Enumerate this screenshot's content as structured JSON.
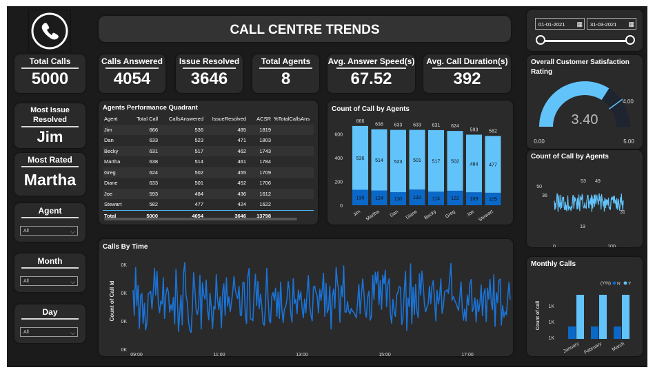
{
  "header": {
    "title": "CALL CENTRE TRENDS"
  },
  "date_range": {
    "start": "01-01-2021",
    "end": "31-03-2021",
    "selected_fraction": [
      0,
      1
    ]
  },
  "kpis": {
    "total_calls": {
      "label": "Total Calls",
      "value": "5000"
    },
    "calls_answered": {
      "label": "Calls Answered",
      "value": "4054"
    },
    "issue_resolved": {
      "label": "Issue Resolved",
      "value": "3646"
    },
    "total_agents": {
      "label": "Total Agents",
      "value": "8"
    },
    "avg_answer_speed": {
      "label": "Avg. Answer Speed(s)",
      "value": "67.52"
    },
    "avg_call_duration": {
      "label": "Avg. Call Duration(s)",
      "value": "392"
    }
  },
  "most_issue_resolved": {
    "label": "Most Issue Resolved",
    "value": "Jim"
  },
  "most_rated": {
    "label": "Most Rated",
    "value": "Martha"
  },
  "slicers": {
    "agent": {
      "label": "Agent",
      "value": "All"
    },
    "month": {
      "label": "Month",
      "value": "All"
    },
    "day": {
      "label": "Day",
      "value": "All"
    }
  },
  "table": {
    "title": "Agents Performance Quadrant",
    "columns": [
      "Agent",
      "Total Call",
      "CallsAnswered",
      "IssueResolved",
      "ACSR",
      "%TotalCallsAns"
    ],
    "rows": [
      [
        "Jim",
        "666",
        "536",
        "485",
        "1819"
      ],
      [
        "Dan",
        "633",
        "523",
        "471",
        "1803"
      ],
      [
        "Becky",
        "631",
        "517",
        "462",
        "1743"
      ],
      [
        "Martha",
        "638",
        "514",
        "461",
        "1784"
      ],
      [
        "Greg",
        "624",
        "502",
        "455",
        "1709"
      ],
      [
        "Diane",
        "633",
        "501",
        "452",
        "1706"
      ],
      [
        "Joe",
        "593",
        "484",
        "436",
        "1612"
      ],
      [
        "Stewart",
        "582",
        "477",
        "424",
        "1622"
      ]
    ],
    "total": [
      "Total",
      "5000",
      "4054",
      "3646",
      "13798"
    ]
  },
  "chart_data": [
    {
      "type": "bar",
      "title": "Count of Call by Agents",
      "stacked": true,
      "categories": [
        "Jim",
        "Martha",
        "Dan",
        "Diane",
        "Becky",
        "Greg",
        "Joe",
        "Stewart"
      ],
      "totals": [
        666,
        638,
        633,
        633,
        631,
        624,
        593,
        582
      ],
      "series": [
        {
          "values": [
            130,
            124,
            110,
            132,
            114,
            122,
            109,
            105
          ],
          "color": "#0a68c9"
        },
        {
          "values": [
            536,
            514,
            523,
            501,
            517,
            502,
            484,
            477
          ],
          "color": "#62c3fb"
        }
      ],
      "yticks": [
        0,
        200,
        400,
        600
      ],
      "ylim": [
        0,
        700
      ]
    },
    {
      "type": "line",
      "title": "Calls By Time",
      "ylabel": "Count of Call Id",
      "yticks": [
        "0K",
        "0K",
        "0K",
        "0K"
      ],
      "xticks": [
        "09:00",
        "11:00",
        "13:00",
        "15:00",
        "17:00"
      ],
      "color": "#1b73d6"
    },
    {
      "type": "line",
      "title": "Count of Call by Agents",
      "ytick": "50",
      "xticks": [
        "0",
        "100"
      ],
      "labels": [
        "36",
        "53",
        "49",
        "19",
        "31"
      ],
      "color": "#62c3fb"
    },
    {
      "type": "bar",
      "title": "Monthly Calls",
      "ylabel": "Count of call",
      "legend_title": "(Y/N)",
      "legend": [
        "N",
        "Y"
      ],
      "categories": [
        "January",
        "February",
        "March"
      ],
      "yticks": [
        "1K",
        "1K",
        "1K"
      ],
      "series": [
        {
          "name": "N",
          "values": [
            0.28,
            0.28,
            0.28
          ],
          "color": "#0a68c9"
        },
        {
          "name": "Y",
          "values": [
            1.0,
            1.0,
            1.0
          ],
          "color": "#62c3fb"
        }
      ]
    }
  ],
  "gauge": {
    "title": "Overall Customer Satisfaction Rating",
    "value": 3.4,
    "value_label": "3.40",
    "min": 0,
    "max": 5,
    "min_label": "0.00",
    "max_label": "5.00",
    "target": 4,
    "target_label": "4.00",
    "fill_color": "#62c3fb"
  }
}
